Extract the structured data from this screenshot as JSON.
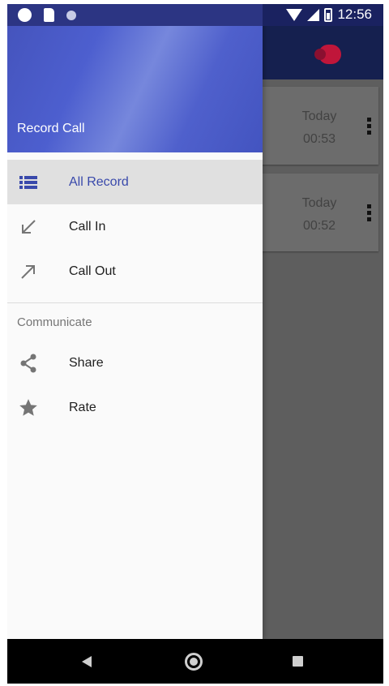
{
  "status_bar": {
    "time": "12:56"
  },
  "drawer": {
    "title": "Record Call",
    "items": [
      {
        "label": "All Record",
        "icon": "list-icon",
        "active": true
      },
      {
        "label": "Call In",
        "icon": "call-in-arrow-icon"
      },
      {
        "label": "Call Out",
        "icon": "call-out-arrow-icon"
      }
    ],
    "section_title": "Communicate",
    "section_items": [
      {
        "label": "Share",
        "icon": "share-icon"
      },
      {
        "label": "Rate",
        "icon": "star-icon"
      }
    ]
  },
  "records": [
    {
      "date": "Today",
      "duration": "00:53"
    },
    {
      "date": "Today",
      "duration": "00:52"
    }
  ],
  "colors": {
    "accent": "#3949ab",
    "header_gradient": "#4d5fcf",
    "recording": "#c0163a"
  }
}
